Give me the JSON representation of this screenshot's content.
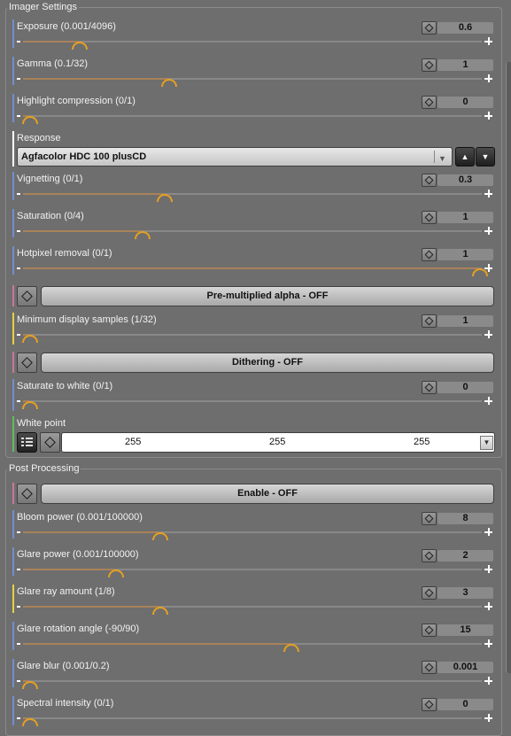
{
  "imager_settings": {
    "title": "Imager Settings",
    "exposure": {
      "label": "Exposure (0.001/4096)",
      "value": "0.6"
    },
    "gamma": {
      "label": "Gamma (0.1/32)",
      "value": "1"
    },
    "highlight_compression": {
      "label": "Highlight compression (0/1)",
      "value": "0"
    },
    "response": {
      "label": "Response",
      "selected": "Agfacolor HDC 100 plusCD",
      "up_glyph": "▲",
      "down_glyph": "▼",
      "combo_glyph": "▼"
    },
    "vignetting": {
      "label": "Vignetting (0/1)",
      "value": "0.3"
    },
    "saturation": {
      "label": "Saturation (0/4)",
      "value": "1"
    },
    "hotpixel_removal": {
      "label": "Hotpixel removal (0/1)",
      "value": "1"
    },
    "premultiplied_alpha": {
      "label": "Pre-multiplied alpha - OFF"
    },
    "min_display_samples": {
      "label": "Minimum display samples (1/32)",
      "value": "1"
    },
    "dithering": {
      "label": "Dithering - OFF"
    },
    "saturate_to_white": {
      "label": "Saturate to white (0/1)",
      "value": "0"
    },
    "white_point": {
      "label": "White point",
      "r": "255",
      "g": "255",
      "b": "255",
      "arrow_glyph": "▼"
    }
  },
  "post_processing": {
    "title": "Post Processing",
    "enable": {
      "label": "Enable - OFF"
    },
    "bloom_power": {
      "label": "Bloom power (0.001/100000)",
      "value": "8"
    },
    "glare_power": {
      "label": "Glare power (0.001/100000)",
      "value": "2"
    },
    "glare_ray_amount": {
      "label": "Glare ray amount (1/8)",
      "value": "3"
    },
    "glare_rotation_angle": {
      "label": "Glare rotation angle (-90/90)",
      "value": "15"
    },
    "glare_blur": {
      "label": "Glare blur (0.001/0.2)",
      "value": "0.001"
    },
    "spectral_intensity": {
      "label": "Spectral intensity (0/1)",
      "value": "0"
    }
  },
  "slider_levels": {
    "exposure": 0.11,
    "gamma": 0.31,
    "highlight_compression": 0.0,
    "vignetting": 0.3,
    "saturation": 0.25,
    "hotpixel_removal": 1.0,
    "min_display_samples": 0.0,
    "saturate_to_white": 0.0,
    "bloom_power": 0.29,
    "glare_power": 0.19,
    "glare_ray_amount": 0.29,
    "glare_rotation_angle": 0.58,
    "glare_blur": 0.0,
    "spectral_intensity": 0.0
  },
  "colors": {
    "panel_bg": "#6e6e6e",
    "knob": "#e6a020",
    "stripe_blue": "#6f8fd0",
    "stripe_pink": "#c8789a",
    "stripe_yellow": "#e8d040",
    "stripe_white": "#ffffff",
    "stripe_green": "#5cbf5c"
  },
  "icons": [
    "reset-diamond-icon",
    "plus-icon",
    "minus-icon",
    "arrow-up-icon",
    "arrow-down-icon",
    "list-icon",
    "dropdown-arrow-icon"
  ]
}
